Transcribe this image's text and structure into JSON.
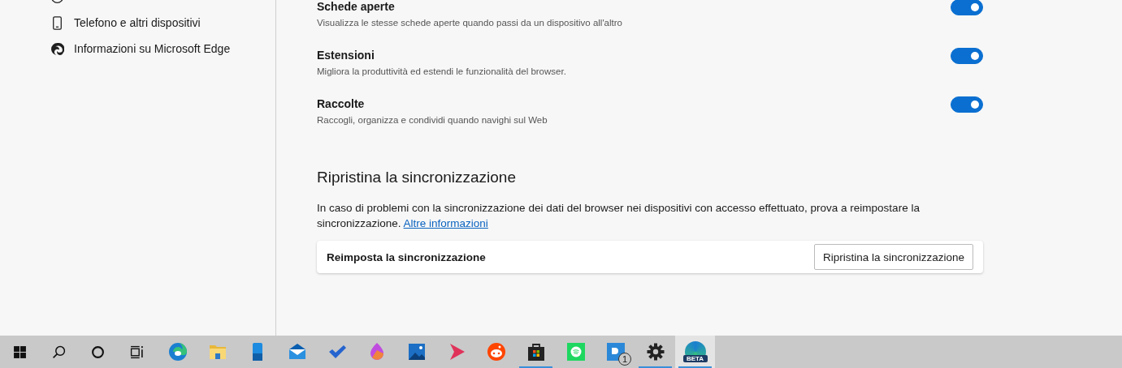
{
  "sidebar": {
    "items": [
      {
        "kind": "phone",
        "label": "Telefono e altri dispositivi"
      },
      {
        "kind": "edge",
        "label": "Informazioni su Microsoft Edge"
      }
    ]
  },
  "sync_items": [
    {
      "title": "Schede aperte",
      "description": "Visualizza le stesse schede aperte quando passi da un dispositivo all'altro",
      "on": true
    },
    {
      "title": "Estensioni",
      "description": "Migliora la produttività ed estendi le funzionalità del browser.",
      "on": true
    },
    {
      "title": "Raccolte",
      "description": "Raccogli, organizza e condividi quando navighi sul Web",
      "on": true
    }
  ],
  "reset_section": {
    "heading": "Ripristina la sincronizzazione",
    "text": "In caso di problemi con la sincronizzazione dei dati del browser nei dispositivi con accesso effettuato, prova a reimpostare la sincronizzazione.",
    "link": "Altre informazioni",
    "card_label": "Reimposta la sincronizzazione",
    "button": "Ripristina la sincronizzazione"
  },
  "taskbar": {
    "system": [
      {
        "kind": "start"
      },
      {
        "kind": "search"
      },
      {
        "kind": "cortana"
      },
      {
        "kind": "taskview"
      }
    ],
    "apps": [
      {
        "kind": "edge",
        "running": false,
        "selected": false
      },
      {
        "kind": "folder",
        "running": false,
        "selected": false
      },
      {
        "kind": "phone",
        "running": false,
        "selected": false
      },
      {
        "kind": "mail",
        "running": false,
        "selected": false
      },
      {
        "kind": "check",
        "running": false,
        "selected": false
      },
      {
        "kind": "drop",
        "running": false,
        "selected": false
      },
      {
        "kind": "photos",
        "running": false,
        "selected": false
      },
      {
        "kind": "play",
        "running": false,
        "selected": false
      },
      {
        "kind": "alien",
        "running": false,
        "selected": false
      },
      {
        "kind": "store",
        "running": true,
        "selected": false
      },
      {
        "kind": "music",
        "running": false,
        "selected": false
      },
      {
        "kind": "chat",
        "running": false,
        "selected": false,
        "badge": "1"
      },
      {
        "kind": "gear",
        "running": true,
        "selected": false
      },
      {
        "kind": "edgebeta",
        "running": true,
        "selected": true,
        "label": "BETA"
      }
    ]
  }
}
